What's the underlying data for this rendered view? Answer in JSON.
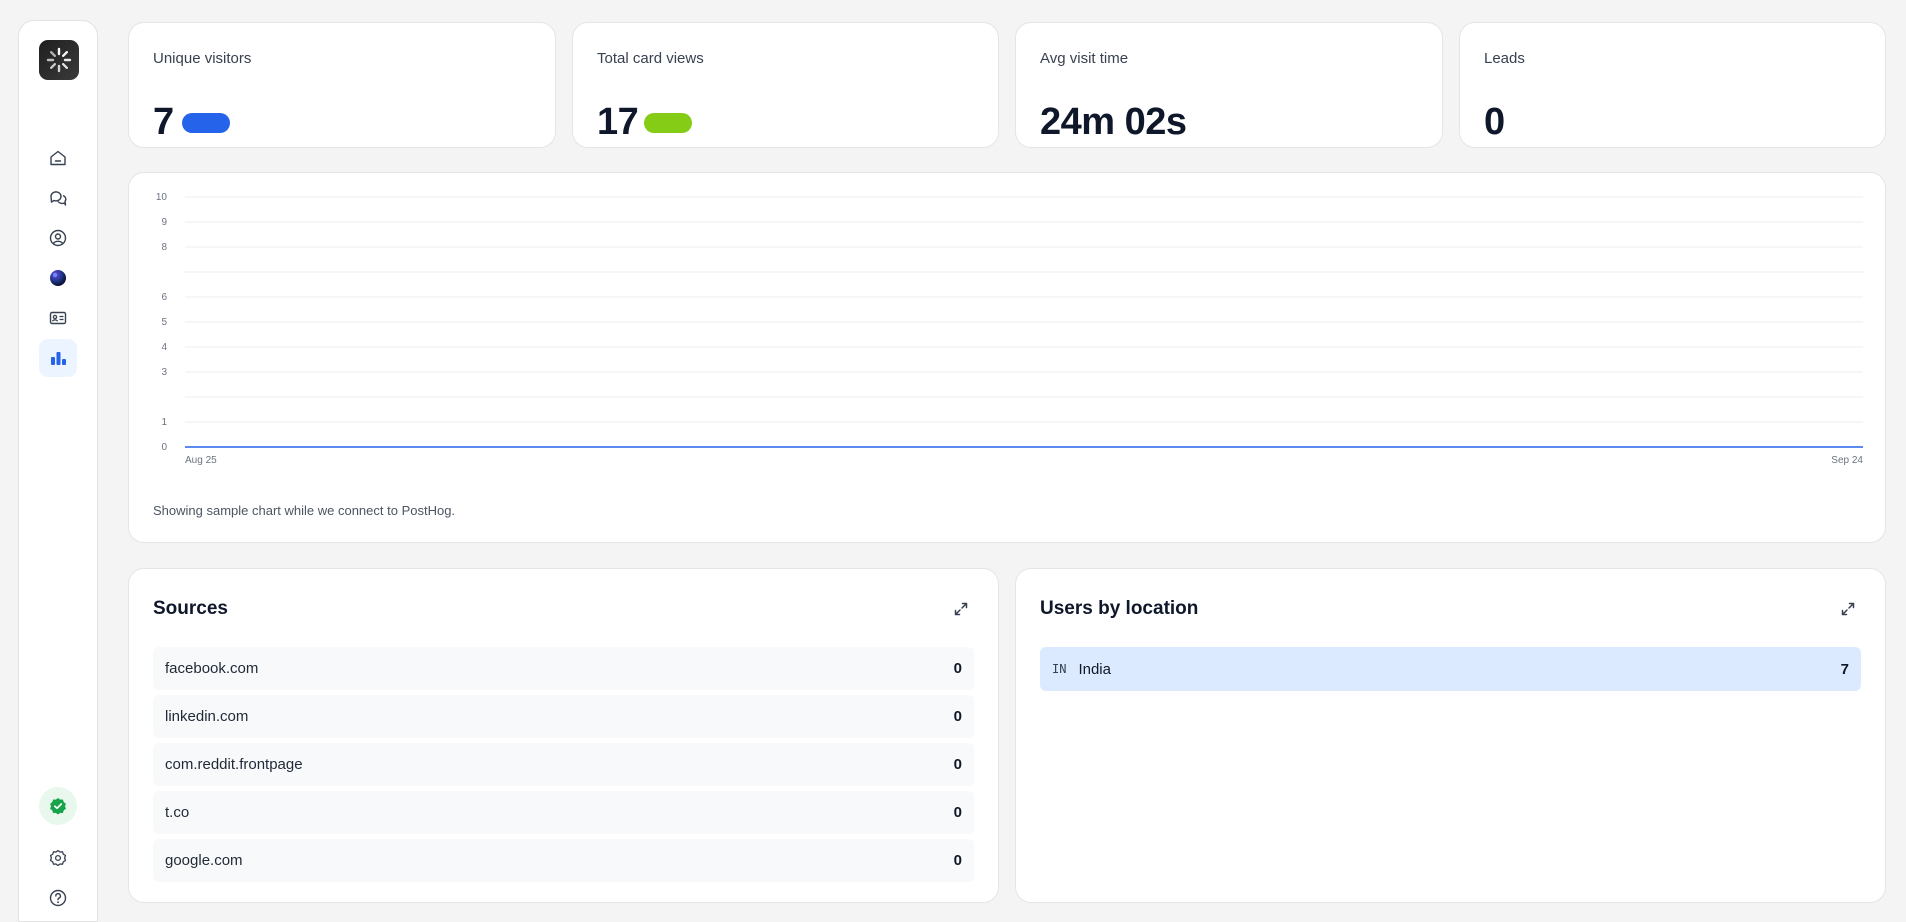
{
  "stats": [
    {
      "label": "Unique visitors",
      "value": "7",
      "pill_color": "#2563eb"
    },
    {
      "label": "Total card views",
      "value": "17",
      "pill_color": "#84cc16"
    },
    {
      "label": "Avg visit time",
      "value": "24m 02s"
    },
    {
      "label": "Leads",
      "value": "0"
    }
  ],
  "chart": {
    "note": "Showing sample chart while we connect to PostHog."
  },
  "chart_data": {
    "type": "line",
    "x_labels": [
      "Aug 25",
      "Sep 24"
    ],
    "y_ticks": [
      0,
      1,
      3,
      4,
      5,
      6,
      8,
      9,
      10
    ],
    "ylim": [
      0,
      10
    ],
    "series": [
      {
        "values": [
          0,
          0
        ],
        "color": "#2563eb"
      }
    ],
    "grid": true
  },
  "sources": {
    "title": "Sources",
    "rows": [
      {
        "label": "facebook.com",
        "count": "0"
      },
      {
        "label": "linkedin.com",
        "count": "0"
      },
      {
        "label": "com.reddit.frontpage",
        "count": "0"
      },
      {
        "label": "t.co",
        "count": "0"
      },
      {
        "label": "google.com",
        "count": "0"
      }
    ]
  },
  "locations": {
    "title": "Users by location",
    "rows": [
      {
        "code": "IN",
        "label": "India",
        "count": "7"
      }
    ]
  },
  "sidebar": {
    "icons": [
      "home-icon",
      "chat-icon",
      "user-circle-icon",
      "globe-icon",
      "id-card-icon",
      "bar-chart-icon",
      "verified-badge-icon",
      "settings-icon",
      "help-icon"
    ],
    "accent": "#2563eb"
  }
}
